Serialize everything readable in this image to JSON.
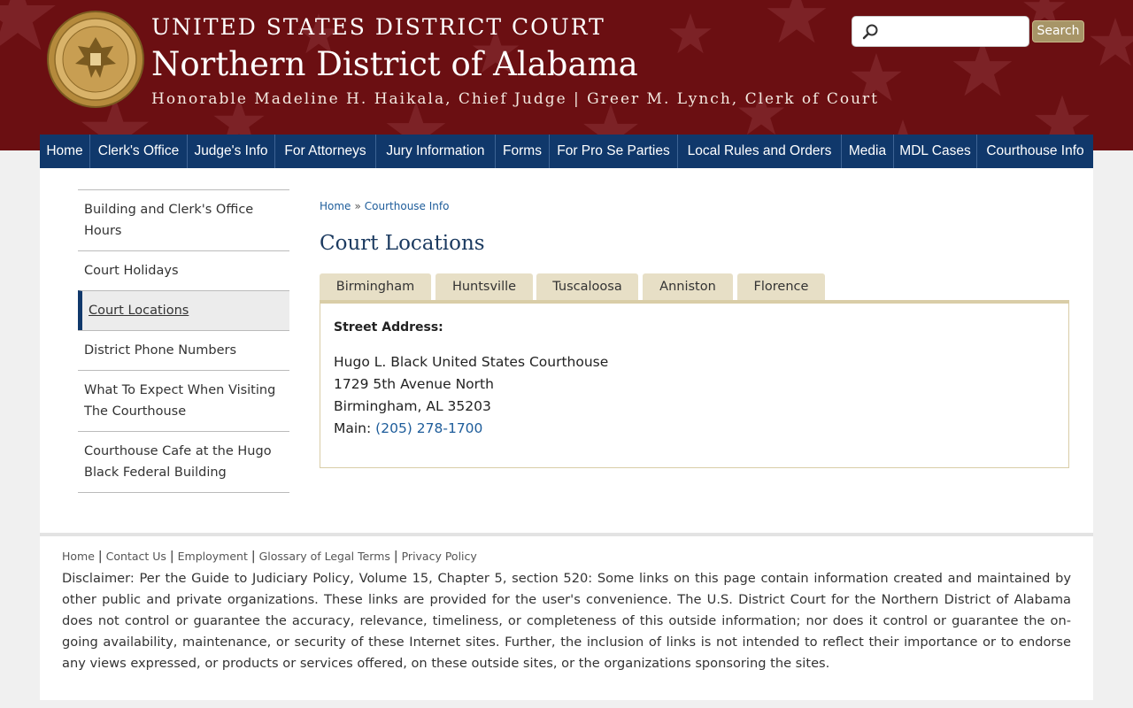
{
  "header": {
    "court": "UNITED STATES DISTRICT COURT",
    "district": "Northern District of Alabama",
    "officials": "Honorable Madeline H. Haikala, Chief Judge | Greer M. Lynch, Clerk of Court",
    "seal_icon": "us-court-seal-icon",
    "search": {
      "placeholder": "",
      "value": "",
      "button_label": "Search"
    }
  },
  "nav": {
    "items": [
      {
        "label": "Home"
      },
      {
        "label": "Clerk's Office"
      },
      {
        "label": "Judge's Info"
      },
      {
        "label": "For Attorneys"
      },
      {
        "label": "Jury Information"
      },
      {
        "label": "Forms"
      },
      {
        "label": "For Pro Se Parties"
      },
      {
        "label": "Local Rules and Orders"
      },
      {
        "label": "Media"
      },
      {
        "label": "MDL Cases"
      },
      {
        "label": "Courthouse Info"
      }
    ]
  },
  "sidebar": {
    "items": [
      {
        "label": "Building and Clerk's Office Hours"
      },
      {
        "label": "Court Holidays"
      },
      {
        "label": "Court Locations",
        "active": true
      },
      {
        "label": "District Phone Numbers"
      },
      {
        "label": "What To Expect When Visiting The Courthouse"
      },
      {
        "label": "Courthouse Cafe at the Hugo Black Federal Building"
      }
    ]
  },
  "breadcrumb": {
    "home": "Home",
    "separator": "»",
    "current": "Courthouse Info"
  },
  "page_title": "Court Locations",
  "tabs": [
    {
      "label": "Birmingham",
      "active": true
    },
    {
      "label": "Huntsville"
    },
    {
      "label": "Tuscaloosa"
    },
    {
      "label": "Anniston"
    },
    {
      "label": "Florence"
    }
  ],
  "location": {
    "street_label": "Street Address:",
    "name": "Hugo L. Black United States Courthouse",
    "street": "1729 5th Avenue North",
    "city": "Birmingham, AL 35203",
    "main_label": "Main:",
    "main_phone": "(205) 278-1700"
  },
  "footer": {
    "links": [
      "Home",
      "Contact Us",
      "Employment",
      "Glossary of Legal Terms",
      "Privacy Policy"
    ],
    "disclaimer": "Disclaimer: Per the Guide to Judiciary Policy, Volume 15, Chapter 5, section 520: Some links on this page contain information created and maintained by other public and private organizations. These links are provided for the user's convenience. The U.S. District Court for the Northern District of Alabama does not control or guarantee the accuracy, relevance, timeliness, or completeness of this outside information; nor does it control or guarantee the on-going availability, maintenance, or security of these Internet sites. Further, the inclusion of links is not intended to reflect their importance or to endorse any views expressed, or products or services offered, on these outside sites, or the organizations sponsoring the sites."
  },
  "colors": {
    "header_bg": "#6b0f12",
    "nav_bg": "#10386b",
    "tab_bg": "#e7dfc6",
    "link": "#1d5c9a",
    "search_button": "#a79567"
  }
}
